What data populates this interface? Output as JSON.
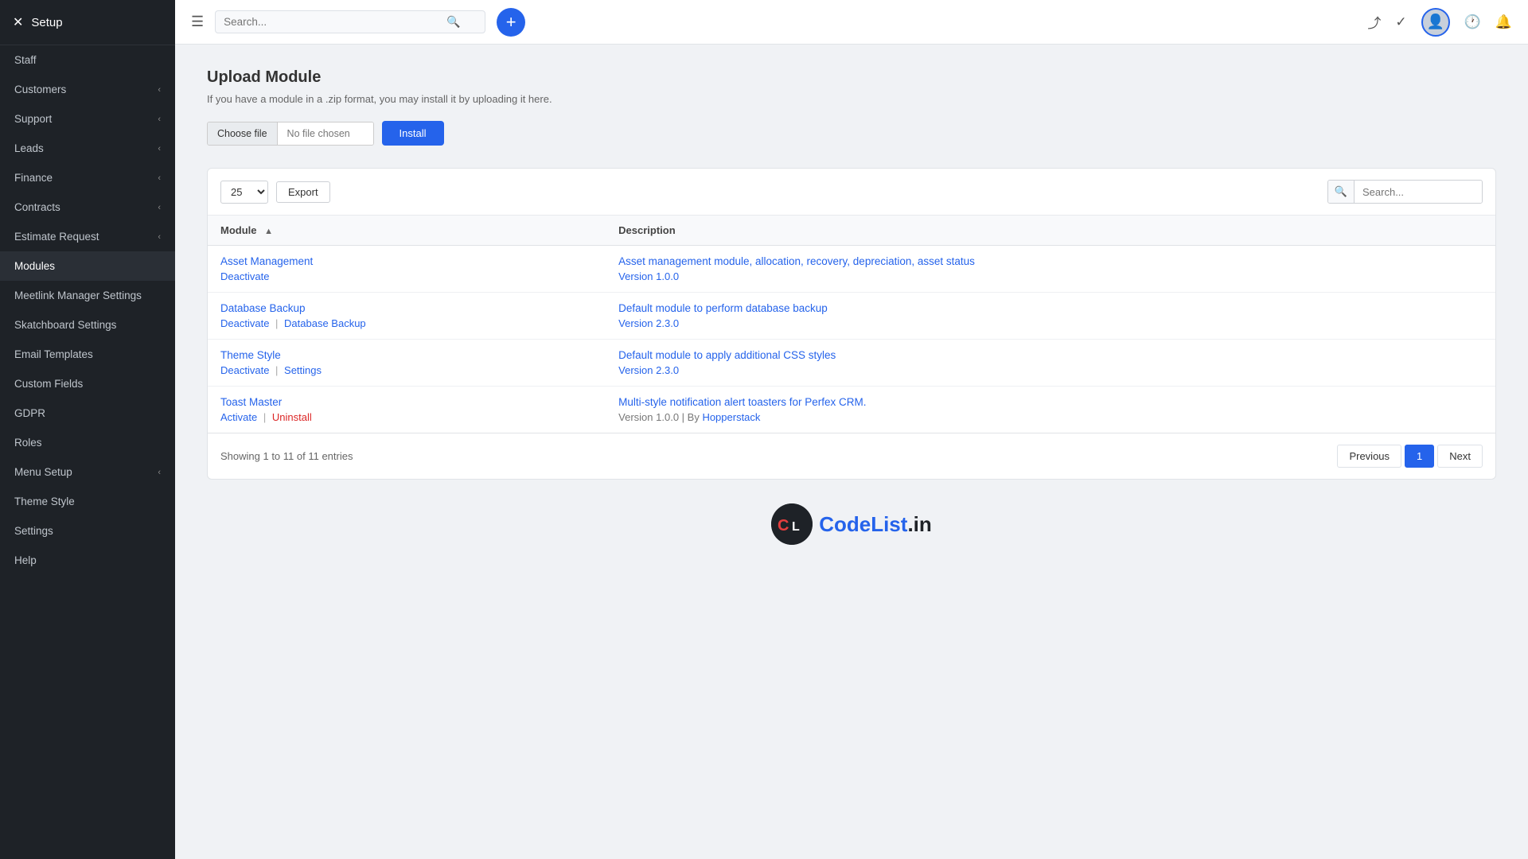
{
  "sidebar": {
    "header": "Setup",
    "close_icon": "✕",
    "items": [
      {
        "label": "Staff",
        "has_chevron": false
      },
      {
        "label": "Customers",
        "has_chevron": true
      },
      {
        "label": "Support",
        "has_chevron": true
      },
      {
        "label": "Leads",
        "has_chevron": true
      },
      {
        "label": "Finance",
        "has_chevron": true
      },
      {
        "label": "Contracts",
        "has_chevron": true
      },
      {
        "label": "Estimate Request",
        "has_chevron": true
      },
      {
        "label": "Modules",
        "has_chevron": false,
        "active": true
      },
      {
        "label": "Meetlink Manager Settings",
        "has_chevron": false
      },
      {
        "label": "Skatchboard Settings",
        "has_chevron": false
      },
      {
        "label": "Email Templates",
        "has_chevron": false
      },
      {
        "label": "Custom Fields",
        "has_chevron": false
      },
      {
        "label": "GDPR",
        "has_chevron": false
      },
      {
        "label": "Roles",
        "has_chevron": false
      },
      {
        "label": "Menu Setup",
        "has_chevron": true
      },
      {
        "label": "Theme Style",
        "has_chevron": false
      },
      {
        "label": "Settings",
        "has_chevron": false
      },
      {
        "label": "Help",
        "has_chevron": false
      }
    ]
  },
  "topbar": {
    "search_placeholder": "Search...",
    "add_icon": "+",
    "menu_icon": "☰"
  },
  "page": {
    "title": "Upload Module",
    "subtitle": "If you have a module in a .zip format, you may install it by uploading it here.",
    "choose_file_label": "Choose file",
    "no_file_label": "No file chosen",
    "install_label": "Install"
  },
  "table": {
    "per_page": "25",
    "export_label": "Export",
    "search_placeholder": "Search...",
    "columns": [
      {
        "label": "Module",
        "sortable": true
      },
      {
        "label": "Description",
        "sortable": false
      }
    ],
    "rows": [
      {
        "module_name": "Asset Management",
        "module_links": [
          {
            "label": "Deactivate",
            "type": "blue"
          }
        ],
        "description": "Asset management module, allocation, recovery, depreciation, asset status",
        "version": "Version 1.0.0",
        "extra_links": []
      },
      {
        "module_name": "Database Backup",
        "module_links": [
          {
            "label": "Deactivate",
            "type": "blue"
          },
          {
            "label": "Database Backup",
            "type": "blue"
          }
        ],
        "description": "Default module to perform database backup",
        "version": "Version 2.3.0",
        "extra_links": []
      },
      {
        "module_name": "Theme Style",
        "module_links": [
          {
            "label": "Deactivate",
            "type": "blue"
          },
          {
            "label": "Settings",
            "type": "blue"
          }
        ],
        "description": "Default module to apply additional CSS styles",
        "version": "Version 2.3.0",
        "extra_links": []
      },
      {
        "module_name": "Toast Master",
        "module_links": [
          {
            "label": "Activate",
            "type": "blue"
          },
          {
            "label": "Uninstall",
            "type": "red"
          }
        ],
        "description": "Multi-style notification alert toasters for Perfex CRM.",
        "version": "Version 1.0.0 | By",
        "version_link": "Hopperstack",
        "extra_links": []
      }
    ],
    "showing_text": "Showing 1 to 11 of 11 entries",
    "pagination": {
      "previous_label": "Previous",
      "next_label": "Next",
      "current_page": 1,
      "pages": [
        1
      ]
    }
  },
  "footer": {
    "logo_text": "CodeList.in",
    "logo_icon_text": "CL"
  }
}
